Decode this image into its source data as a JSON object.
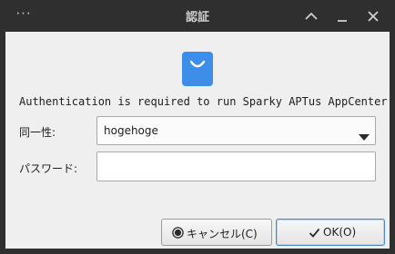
{
  "window": {
    "title": "認証",
    "menu_glyph": "···",
    "controls": [
      "chevron-up-icon",
      "minimize-icon",
      "close-icon"
    ]
  },
  "dialog": {
    "icon": "shopping-bag-icon",
    "message": "Authentication is required to run Sparky APTus AppCenter",
    "identity_label": "同一性:",
    "identity_value": "hogehoge",
    "password_label": "パスワード:",
    "password_value": ""
  },
  "buttons": {
    "cancel_label": "キャンセル(C)",
    "ok_label": "OK(O)"
  },
  "colors": {
    "titlebar": "#2f2f2f",
    "content_bg": "#efefef",
    "accent": "#3d8ee8",
    "focus_border": "#4a86c8"
  }
}
